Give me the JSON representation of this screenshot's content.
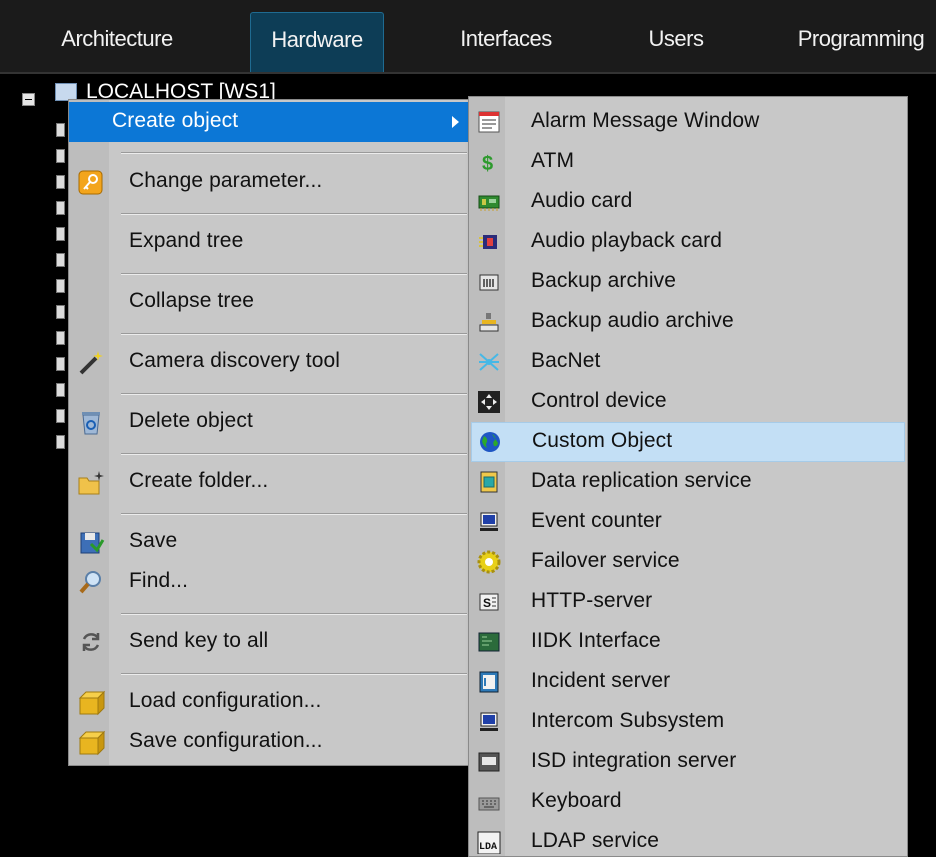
{
  "tabs": [
    {
      "label": "Architecture",
      "active": false
    },
    {
      "label": "Hardware",
      "active": true
    },
    {
      "label": "Interfaces",
      "active": false
    },
    {
      "label": "Users",
      "active": false
    },
    {
      "label": "Programming",
      "active": false
    }
  ],
  "tree": {
    "root_label": "LOCALHOST [WS1]"
  },
  "context_menu": {
    "items": [
      {
        "label": "Create object",
        "icon": "none",
        "has_submenu": true
      },
      {
        "label": "Change parameter...",
        "icon": "key-icon"
      },
      {
        "label": "Expand tree",
        "icon": "none"
      },
      {
        "label": "Collapse tree",
        "icon": "none"
      },
      {
        "label": "Camera discovery tool",
        "icon": "magic-wand-icon"
      },
      {
        "label": "Delete object",
        "icon": "recycle-bin-icon"
      },
      {
        "label": "Create folder...",
        "icon": "new-folder-icon"
      },
      {
        "label": "Save",
        "icon": "save-icon"
      },
      {
        "label": "Find...",
        "icon": "magnifier-icon"
      },
      {
        "label": "Send key to all",
        "icon": "refresh-icon"
      },
      {
        "label": "Load configuration...",
        "icon": "box-icon"
      },
      {
        "label": "Save configuration...",
        "icon": "box-icon"
      }
    ]
  },
  "submenu": {
    "items": [
      {
        "label": "Alarm Message Window",
        "icon": "alarm-window-icon"
      },
      {
        "label": "ATM",
        "icon": "dollar-icon"
      },
      {
        "label": "Audio card",
        "icon": "audio-card-icon"
      },
      {
        "label": "Audio playback card",
        "icon": "audio-playback-icon"
      },
      {
        "label": "Backup archive",
        "icon": "backup-archive-icon"
      },
      {
        "label": "Backup audio archive",
        "icon": "backup-audio-icon"
      },
      {
        "label": "BacNet",
        "icon": "bacnet-icon"
      },
      {
        "label": "Control device",
        "icon": "control-device-icon"
      },
      {
        "label": "Custom Object",
        "icon": "globe-icon",
        "hovered": true
      },
      {
        "label": "Data replication service",
        "icon": "replication-icon"
      },
      {
        "label": "Event counter",
        "icon": "monitor-icon"
      },
      {
        "label": "Failover service",
        "icon": "gear-icon"
      },
      {
        "label": "HTTP-server",
        "icon": "server-icon"
      },
      {
        "label": "IIDK Interface",
        "icon": "board-icon"
      },
      {
        "label": "Incident server",
        "icon": "document-icon"
      },
      {
        "label": "Intercom Subsystem",
        "icon": "monitor-icon"
      },
      {
        "label": "ISD integration server",
        "icon": "device-icon"
      },
      {
        "label": "Keyboard",
        "icon": "keyboard-icon"
      },
      {
        "label": "LDAP service",
        "icon": "ldap-icon"
      }
    ]
  },
  "colors": {
    "menu_highlight": "#0c77d6",
    "submenu_hover": "#c3dff5",
    "active_tab": "#0d3d56"
  }
}
